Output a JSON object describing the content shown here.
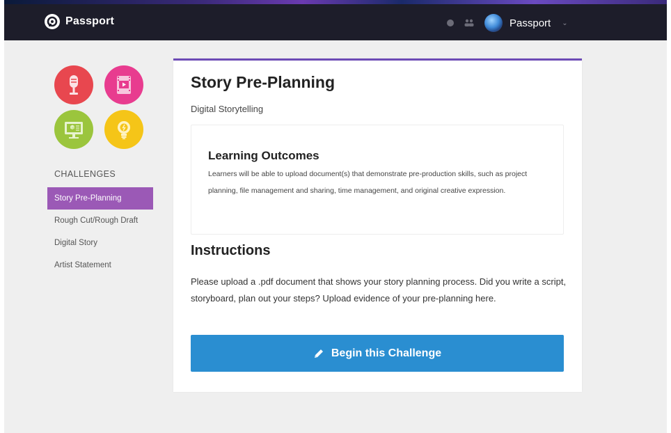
{
  "header": {
    "brand": "Passport",
    "user_name": "Passport"
  },
  "sidebar": {
    "heading": "CHALLENGES",
    "badges": [
      "microphone-badge-icon",
      "film-badge-icon",
      "computer-badge-icon",
      "lightbulb-badge-icon"
    ],
    "items": [
      {
        "label": "Story Pre-Planning",
        "active": true
      },
      {
        "label": "Rough Cut/Rough Draft",
        "active": false
      },
      {
        "label": "Digital Story",
        "active": false
      },
      {
        "label": "Artist Statement",
        "active": false
      }
    ]
  },
  "main": {
    "title": "Story Pre-Planning",
    "subtitle": "Digital Storytelling",
    "outcomes": {
      "heading": "Learning Outcomes",
      "text": "Learners will be able to upload document(s) that demonstrate pre-production skills, such as project planning, file management and sharing, time management, and original creative expression."
    },
    "instructions": {
      "heading": "Instructions",
      "text": "Please upload a .pdf document that shows your story planning process. Did you write a script, storyboard, plan out your steps? Upload evidence of your pre-planning here."
    },
    "button_label": "Begin this Challenge"
  },
  "colors": {
    "navbar": "#1d1d2a",
    "accent_purple": "#9b59b6",
    "card_border": "#6d4ab5",
    "button_blue": "#2a8ed1",
    "badge_red": "#e8474f",
    "badge_pink": "#e83c8f",
    "badge_green": "#9bc53d",
    "badge_yellow": "#f5c518"
  }
}
